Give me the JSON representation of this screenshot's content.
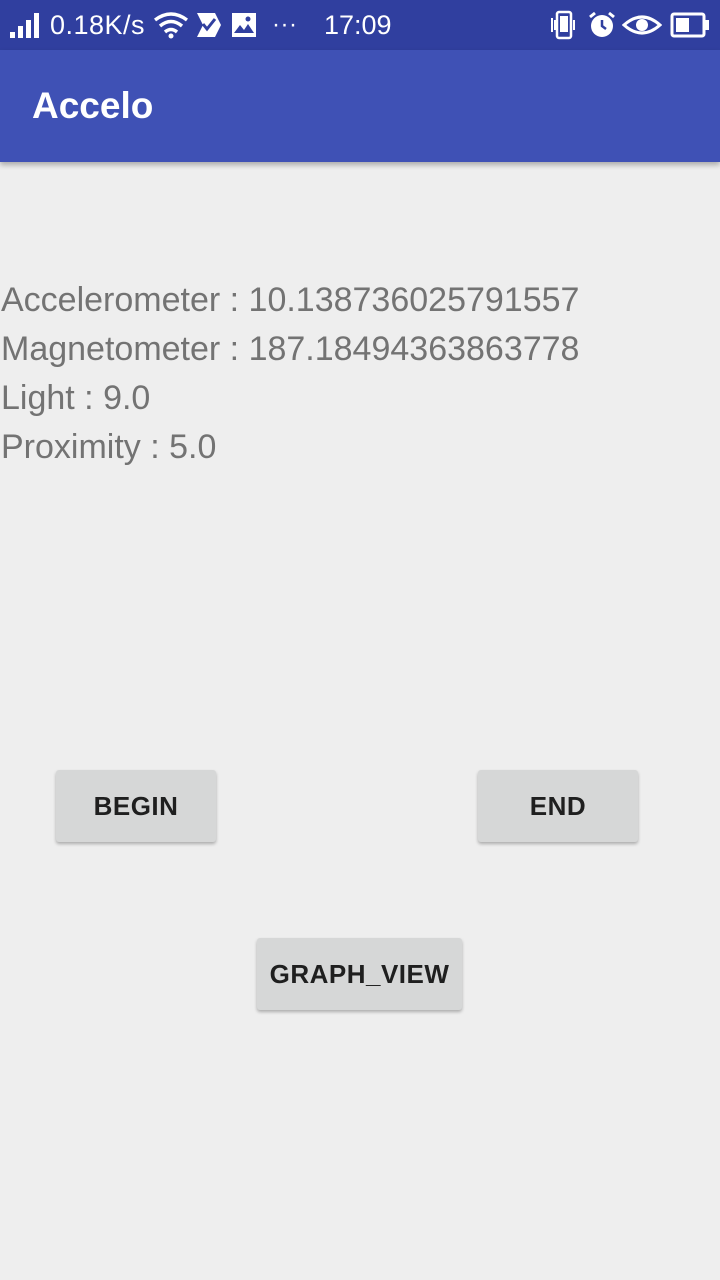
{
  "status_bar": {
    "network_speed": "0.18K/s",
    "more": "···",
    "time": "17:09",
    "background": "#303f9f"
  },
  "app_bar": {
    "title": "Accelo",
    "color": "#3f51b5"
  },
  "readings": [
    {
      "text": "Accelerometer : 10.138736025791557"
    },
    {
      "text": "Magnetometer : 187.18494363863778"
    },
    {
      "text": "Light : 9.0"
    },
    {
      "text": "Proximity : 5.0"
    }
  ],
  "buttons": {
    "begin": "BEGIN",
    "end": "END",
    "graph_view": "GRAPH_VIEW"
  },
  "icons": [
    "signal-icon",
    "wifi-icon",
    "check-notification-icon",
    "image-notification-icon",
    "vibrate-icon",
    "alarm-icon",
    "eye-icon",
    "battery-icon"
  ]
}
